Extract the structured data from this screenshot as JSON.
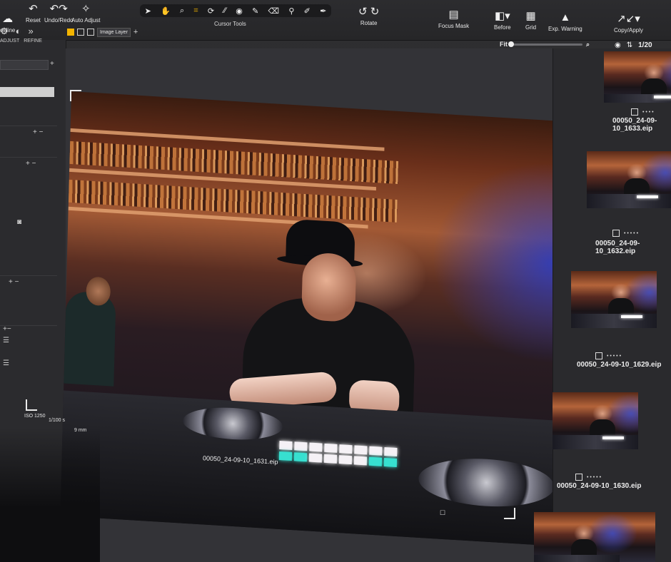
{
  "toolbar": {
    "left_items": [
      {
        "label": "online",
        "icon": "cloud-icon"
      },
      {
        "label": "Reset",
        "icon": "reset-icon"
      },
      {
        "label": "Undo/Redo",
        "icon": "undo-redo-icon"
      },
      {
        "label": "Auto Adjust",
        "icon": "magic-wand-icon"
      }
    ],
    "cursor_tools_label": "Cursor Tools",
    "rotate_label": "Rotate",
    "focus_mask_label": "Focus Mask",
    "before_label": "Before",
    "grid_label": "Grid",
    "exp_warning_label": "Exp. Warning",
    "copy_apply_label": "Copy/Apply"
  },
  "left_panel": {
    "tabs": [
      "ADJUST",
      "REFINE"
    ]
  },
  "layer_bar": {
    "layer_select": "Image Layer",
    "add": "+"
  },
  "viewer": {
    "zoom_label": "Fit",
    "zoom_level": 0.0,
    "image_filename": "00050_24-09-10_1631.eip",
    "exif": {
      "iso": "ISO 1250",
      "shutter": "1/100 s",
      "focal": "9 mm"
    }
  },
  "filmstrip": {
    "counter": "1/20",
    "thumbnails": [
      {
        "name": "00050_24-09-10_1632.eip"
      },
      {
        "name": "00050_24-09-10_1629.eip"
      },
      {
        "name": "00050_24-09-10_1630.eip"
      }
    ],
    "top_thumb_name": "00050_24-09-10_1633.eip"
  },
  "colors": {
    "accent": "#f3b400",
    "panel": "#2b2b2e",
    "viewer_bg": "#333337"
  }
}
